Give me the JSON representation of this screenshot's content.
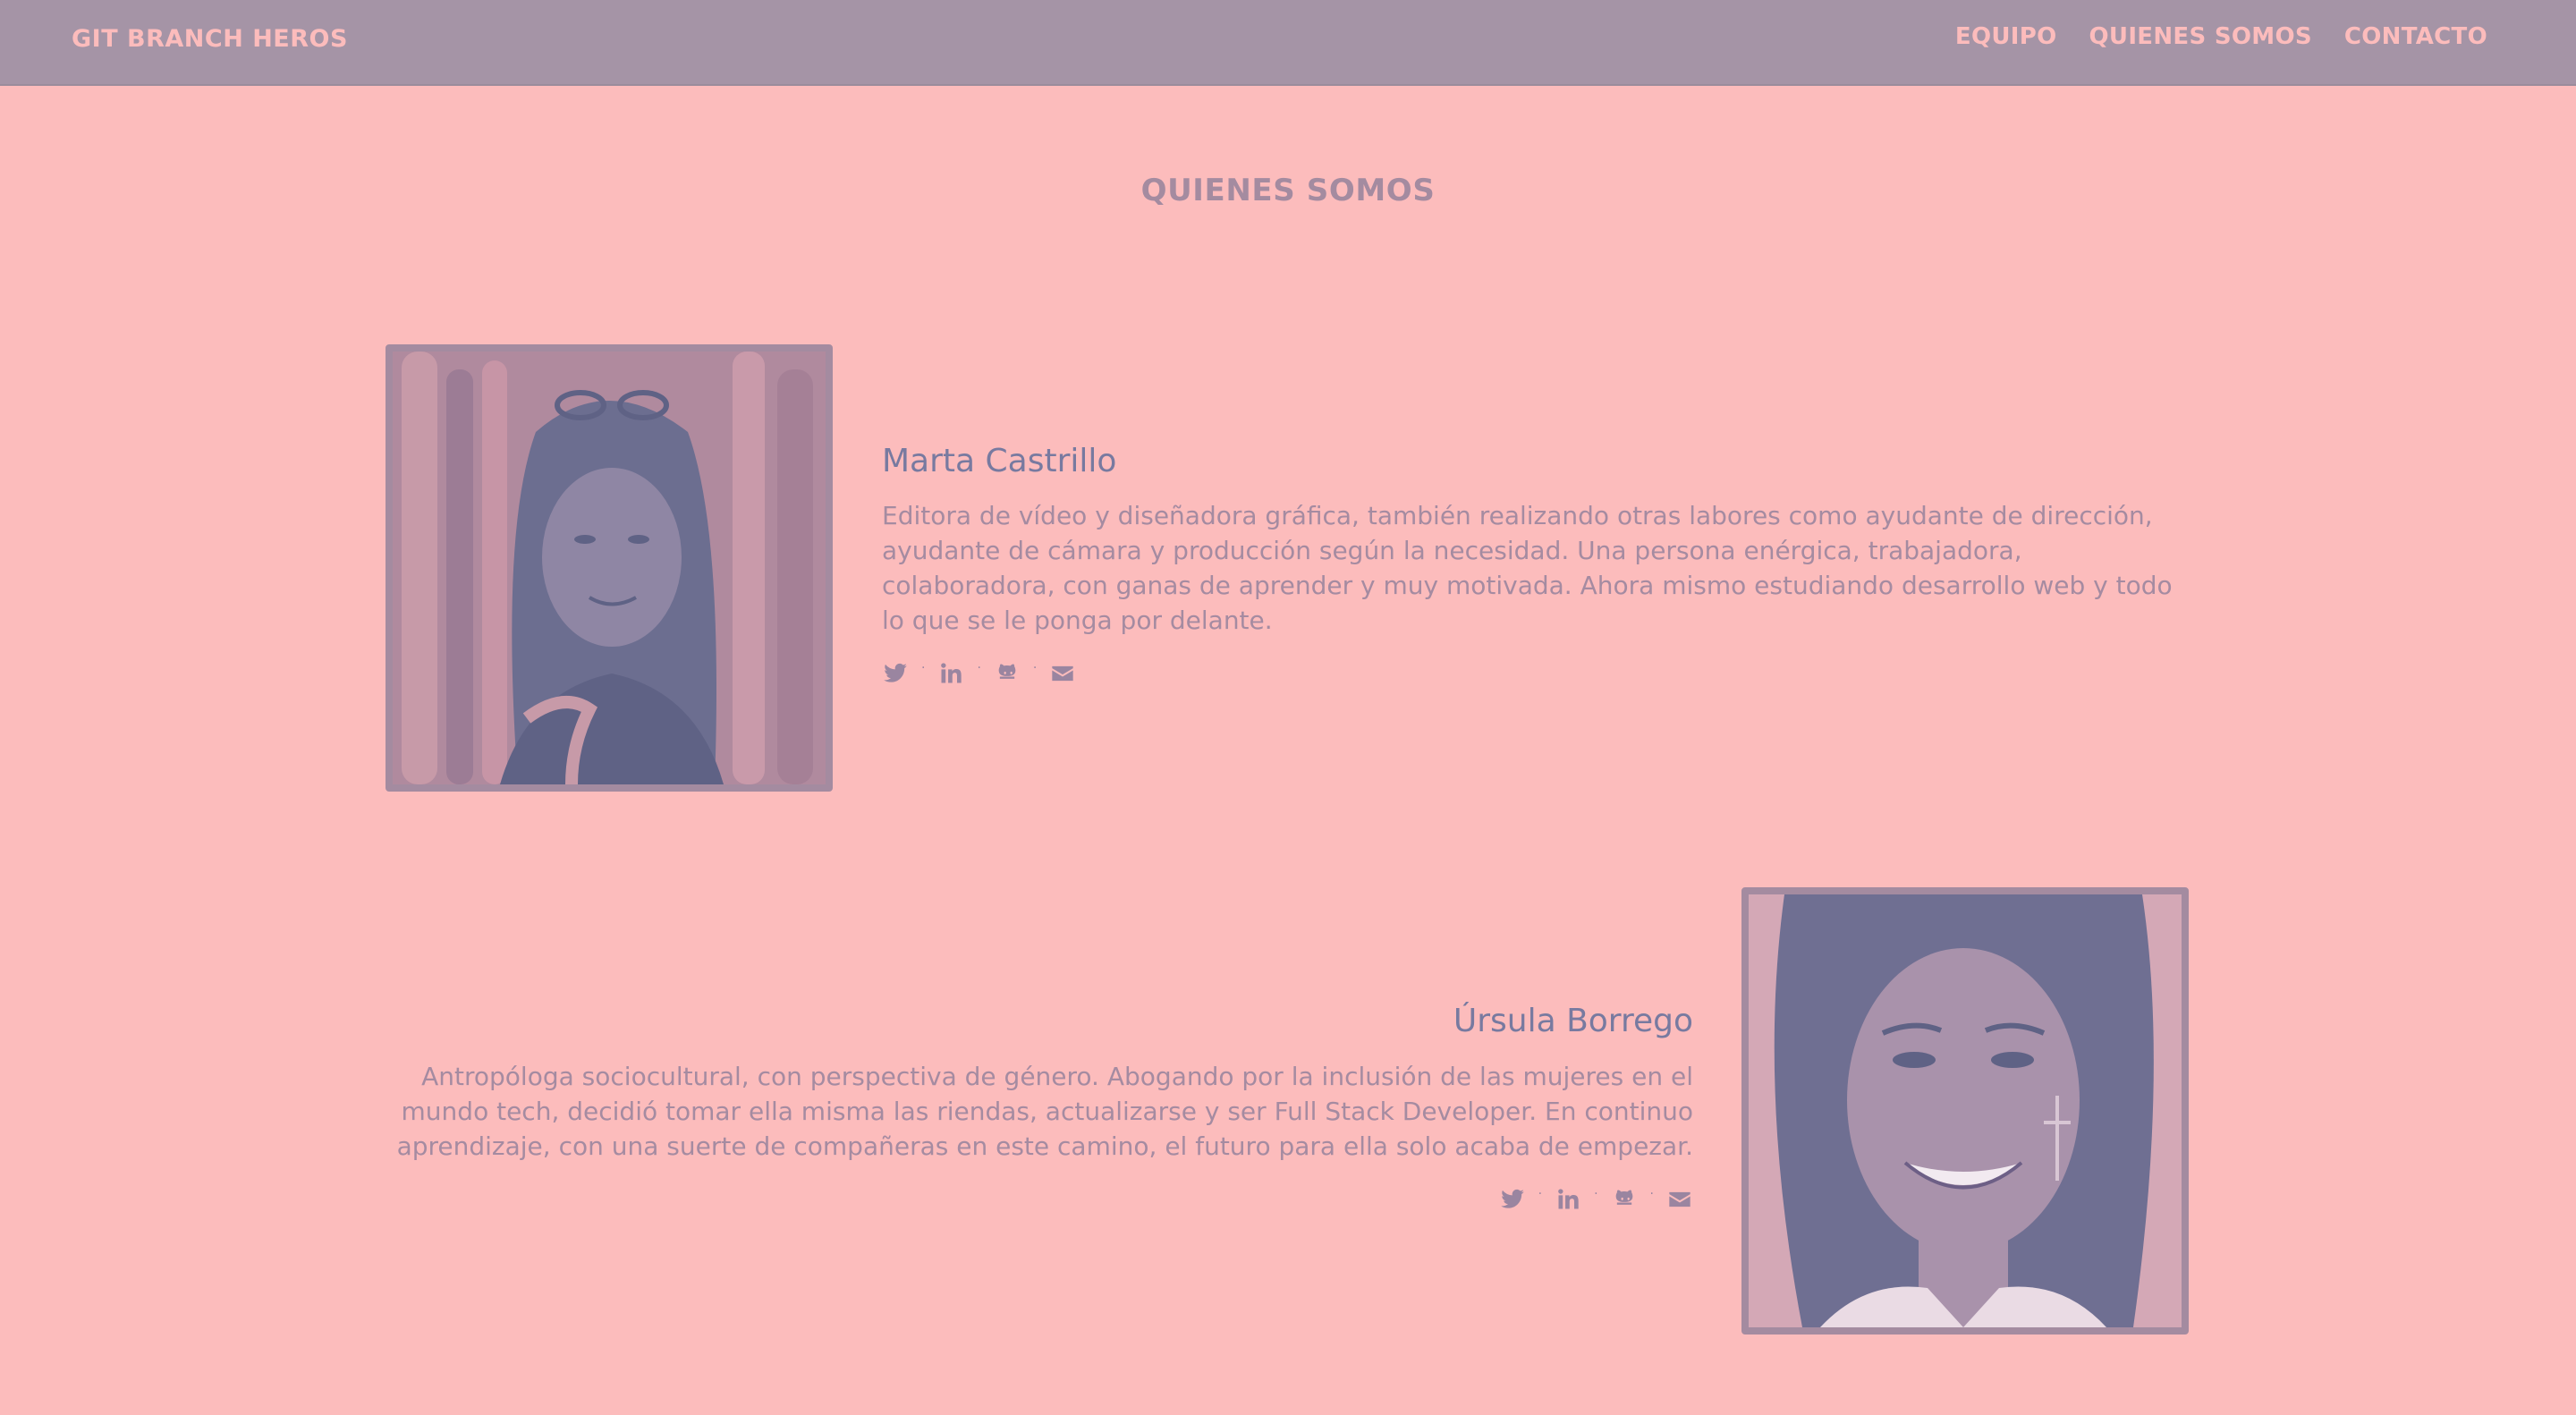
{
  "nav": {
    "brand": "GIT BRANCH HEROS",
    "links": [
      "EQUIPO",
      "QUIENES SOMOS",
      "CONTACTO"
    ]
  },
  "section": {
    "title": "QUIENES SOMOS"
  },
  "members": [
    {
      "name": "Marta Castrillo",
      "bio": "Editora de vídeo y diseñadora gráfica, también realizando otras labores como ayudante de dirección, ayudante de cámara y producción según la necesidad. Una persona enérgica, trabajadora, colaboradora, con ganas de aprender y muy motivada. Ahora mismo estudiando desarrollo web y todo lo que se le ponga por delante.",
      "socials": [
        "twitter-icon",
        "linkedin-icon",
        "github-icon",
        "email-icon"
      ]
    },
    {
      "name": "Úrsula Borrego",
      "bio": "Antropóloga sociocultural, con perspectiva de género. Abogando por la inclusión de las mujeres en el mundo tech, decidió tomar ella misma las riendas, actualizarse y ser Full Stack Developer. En continuo aprendizaje, con una suerte de compañeras en este camino, el futuro para ella solo acaba de empezar.",
      "socials": [
        "twitter-icon",
        "linkedin-icon",
        "github-icon",
        "email-icon"
      ]
    }
  ],
  "colors": {
    "background": "#fcbcbc",
    "navbar": "#a594a6",
    "accent": "#a48ba0",
    "name": "#787aa0"
  }
}
